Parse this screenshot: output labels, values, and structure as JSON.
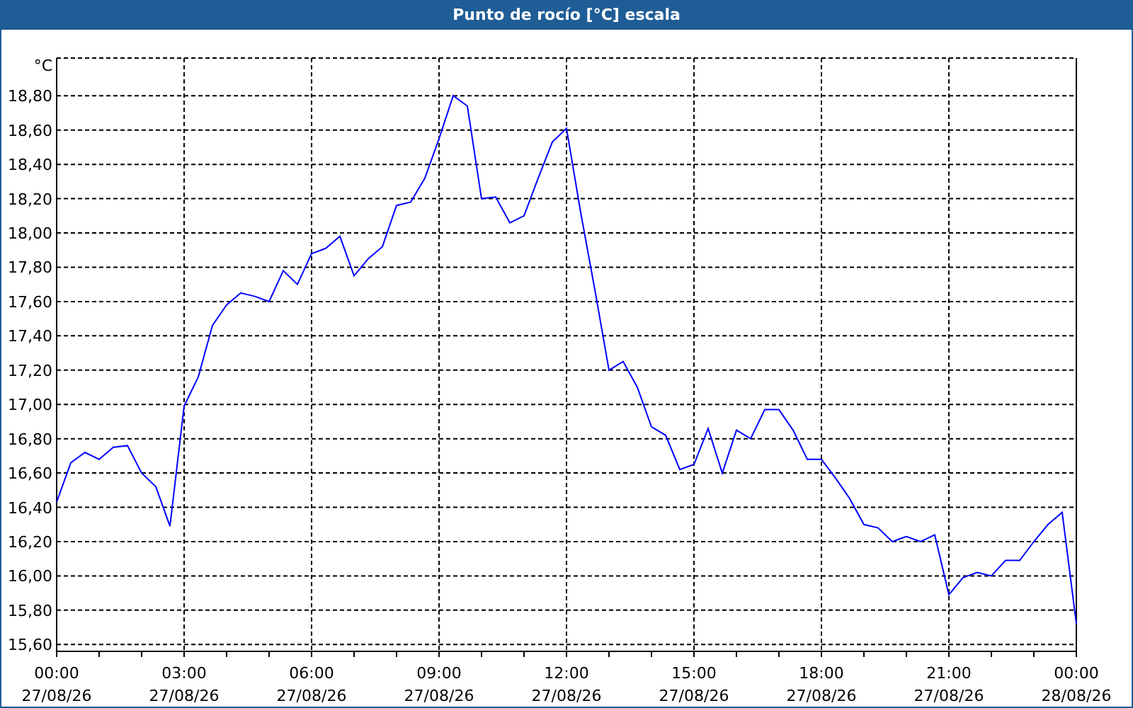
{
  "window": {
    "title": "Punto de rocío [°C] escala"
  },
  "chart": {
    "chart_data": {
      "type": "line",
      "grid": true,
      "ylabel": "°C",
      "ylim": [
        15.56,
        19.02
      ],
      "yticks": [
        {
          "value": 15.6,
          "label": "15,60"
        },
        {
          "value": 15.8,
          "label": "15,80"
        },
        {
          "value": 16.0,
          "label": "16,00"
        },
        {
          "value": 16.2,
          "label": "16,20"
        },
        {
          "value": 16.4,
          "label": "16,40"
        },
        {
          "value": 16.6,
          "label": "16,60"
        },
        {
          "value": 16.8,
          "label": "16,80"
        },
        {
          "value": 17.0,
          "label": "17,00"
        },
        {
          "value": 17.2,
          "label": "17,20"
        },
        {
          "value": 17.4,
          "label": "17,40"
        },
        {
          "value": 17.6,
          "label": "17,60"
        },
        {
          "value": 17.8,
          "label": "17,80"
        },
        {
          "value": 18.0,
          "label": "18,00"
        },
        {
          "value": 18.2,
          "label": "18,20"
        },
        {
          "value": 18.4,
          "label": "18,40"
        },
        {
          "value": 18.6,
          "label": "18,60"
        },
        {
          "value": 18.8,
          "label": "18,80"
        }
      ],
      "categories": [
        "00:00\n27/08/26",
        null,
        null,
        null,
        null,
        null,
        null,
        null,
        null,
        "03:00\n27/08/26",
        null,
        null,
        null,
        null,
        null,
        null,
        null,
        null,
        "06:00\n27/08/26",
        null,
        null,
        null,
        null,
        null,
        null,
        null,
        null,
        "09:00\n27/08/26",
        null,
        null,
        null,
        null,
        null,
        null,
        null,
        null,
        "12:00\n27/08/26",
        null,
        null,
        null,
        null,
        null,
        null,
        null,
        null,
        "15:00\n27/08/26",
        null,
        null,
        null,
        null,
        null,
        null,
        null,
        null,
        "18:00\n27/08/26",
        null,
        null,
        null,
        null,
        null,
        null,
        null,
        null,
        "21:00\n27/08/26",
        null,
        null,
        null,
        null,
        null,
        null,
        null,
        null,
        "00:00\n28/08/26"
      ],
      "series": [
        {
          "color": "#0000ff",
          "values": [
            16.43,
            16.66,
            16.72,
            16.68,
            16.75,
            16.76,
            16.6,
            16.52,
            16.29,
            16.99,
            17.16,
            17.46,
            17.58,
            17.65,
            17.63,
            17.6,
            17.78,
            17.7,
            17.88,
            17.91,
            17.98,
            17.75,
            17.85,
            17.92,
            18.16,
            18.18,
            18.32,
            18.55,
            18.8,
            18.74,
            18.2,
            18.21,
            18.06,
            18.1,
            18.32,
            18.53,
            18.61,
            18.12,
            17.67,
            17.2,
            17.25,
            17.1,
            16.87,
            16.82,
            16.62,
            16.65,
            16.86,
            16.6,
            16.85,
            16.8,
            16.97,
            16.97,
            16.85,
            16.68,
            16.68,
            16.57,
            16.45,
            16.3,
            16.28,
            16.2,
            16.23,
            16.2,
            16.24,
            15.89,
            15.99,
            16.02,
            16.0,
            16.09,
            16.09,
            16.2,
            16.3,
            16.37,
            15.72
          ]
        }
      ]
    }
  }
}
